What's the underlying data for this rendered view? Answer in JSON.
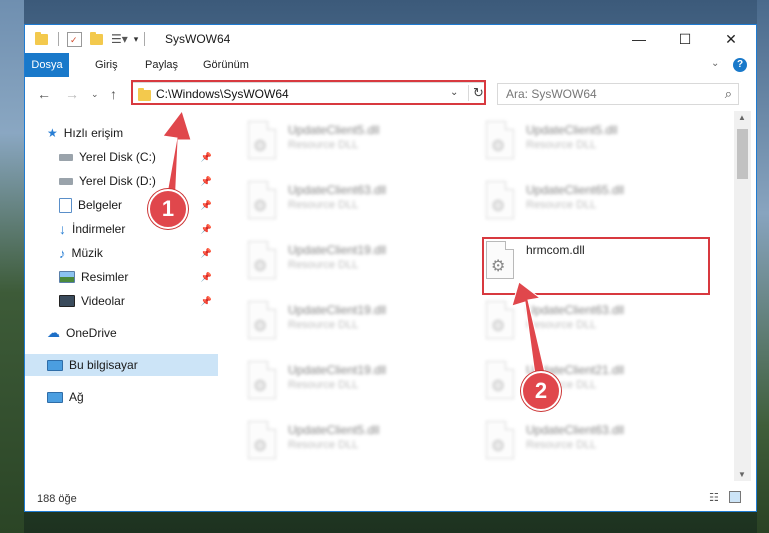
{
  "window": {
    "title": "SysWOW64",
    "controls": {
      "minimize": "—",
      "maximize": "☐",
      "close": "✕"
    }
  },
  "ribbon": {
    "tabs": [
      {
        "label": "Dosya",
        "active": true
      },
      {
        "label": "Giriş",
        "active": false
      },
      {
        "label": "Paylaş",
        "active": false
      },
      {
        "label": "Görünüm",
        "active": false
      }
    ]
  },
  "address": {
    "path": "C:\\Windows\\SysWOW64",
    "search_placeholder": "Ara: SysWOW64"
  },
  "sidebar": {
    "items": [
      {
        "label": "Hızlı erişim",
        "icon": "star-icon"
      },
      {
        "label": "Yerel Disk (C:)",
        "icon": "drive-icon",
        "pinned": true
      },
      {
        "label": "Yerel Disk (D:)",
        "icon": "drive-icon",
        "pinned": true
      },
      {
        "label": "Belgeler",
        "icon": "documents-icon",
        "pinned": true
      },
      {
        "label": "İndirmeler",
        "icon": "download-icon",
        "pinned": true
      },
      {
        "label": "Müzik",
        "icon": "music-icon",
        "pinned": true
      },
      {
        "label": "Resimler",
        "icon": "pictures-icon",
        "pinned": true
      },
      {
        "label": "Videolar",
        "icon": "videos-icon",
        "pinned": true
      },
      {
        "label": "OneDrive",
        "icon": "onedrive-icon"
      },
      {
        "label": "Bu bilgisayar",
        "icon": "computer-icon",
        "selected": true
      },
      {
        "label": "Ağ",
        "icon": "network-icon"
      }
    ]
  },
  "files": [
    {
      "name": "UpdateClient5.dll",
      "type": "Resource DLL"
    },
    {
      "name": "UpdateClient5.dll",
      "type": "Resource DLL"
    },
    {
      "name": "UpdateClient63.dll",
      "type": "Resource DLL"
    },
    {
      "name": "UpdateClient65.dll",
      "type": "Resource DLL"
    },
    {
      "name": "UpdateClient19.dll",
      "type": "Resource DLL"
    },
    {
      "name": "hrmcom.dll",
      "type": ""
    },
    {
      "name": "UpdateClient19.dll",
      "type": "Resource DLL"
    },
    {
      "name": "UpdateClient63.dll",
      "type": "Resource DLL"
    },
    {
      "name": "UpdateClient19.dll",
      "type": "Resource DLL"
    },
    {
      "name": "UpdateClient21.dll",
      "type": "Resource DLL"
    },
    {
      "name": "UpdateClient5.dll",
      "type": "Resource DLL"
    },
    {
      "name": "UpdateClient63.dll",
      "type": "Resource DLL"
    }
  ],
  "status": {
    "count": "188 öğe"
  },
  "markers": {
    "step1": "1",
    "step2": "2"
  },
  "colors": {
    "accent": "#1979ca",
    "highlight": "#d8393f",
    "selected": "#cce4f7"
  }
}
